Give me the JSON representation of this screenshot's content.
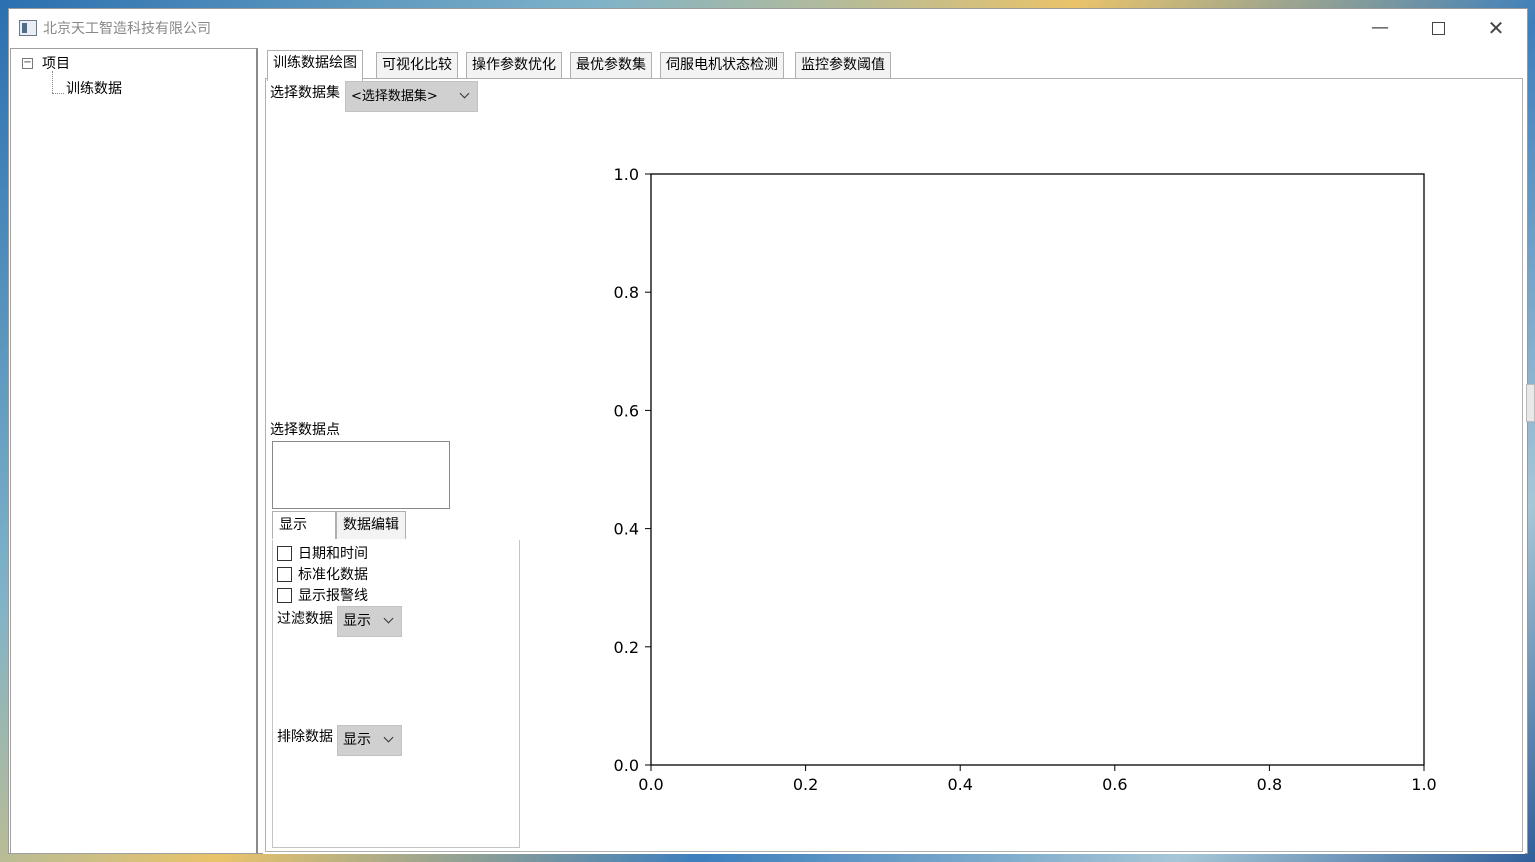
{
  "window": {
    "title": "北京天工智造科技有限公司"
  },
  "tree": {
    "root": "项目",
    "toggle": "−",
    "children": [
      "训练数据"
    ]
  },
  "tabs": [
    {
      "label": "训练数据绘图"
    },
    {
      "label": "可视化比较"
    },
    {
      "label": "操作参数优化"
    },
    {
      "label": "最优参数集"
    },
    {
      "label": "伺服电机状态检测"
    },
    {
      "label": "监控参数阈值"
    }
  ],
  "dataset": {
    "label": "选择数据集",
    "value": "<选择数据集>"
  },
  "datapoint": {
    "label": "选择数据点"
  },
  "subtabs": [
    {
      "label": "显示"
    },
    {
      "label": "数据编辑"
    }
  ],
  "options": {
    "checkboxes": [
      {
        "label": "日期和时间",
        "checked": false
      },
      {
        "label": "标准化数据",
        "checked": false
      },
      {
        "label": "显示报警线",
        "checked": false
      }
    ],
    "filter_label": "过滤数据",
    "filter_value": "显示",
    "exclude_label": "排除数据",
    "exclude_value": "显示"
  },
  "chart_data": {
    "type": "scatter",
    "x": [],
    "y": [],
    "xlim": [
      0.0,
      1.0
    ],
    "ylim": [
      0.0,
      1.0
    ],
    "xticks": [
      "0.0",
      "0.2",
      "0.4",
      "0.6",
      "0.8",
      "1.0"
    ],
    "yticks": [
      "0.0",
      "0.2",
      "0.4",
      "0.6",
      "0.8",
      "1.0"
    ],
    "grid": false
  }
}
